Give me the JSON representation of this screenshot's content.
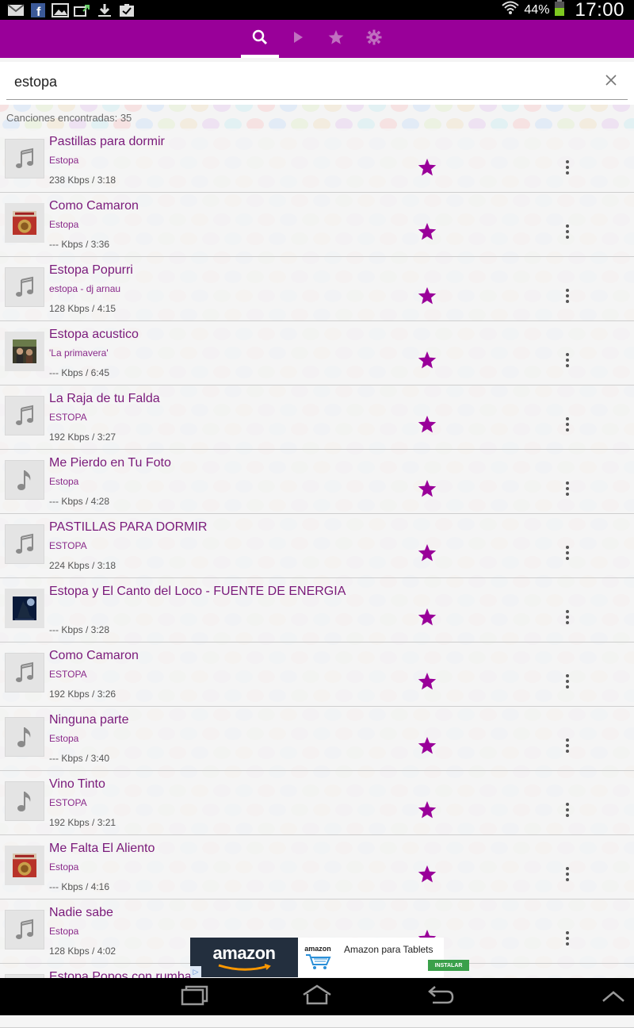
{
  "status_bar": {
    "battery_text": "44%",
    "time": "17:00",
    "notification_icons": [
      "gmail-icon",
      "facebook-icon",
      "gallery-icon",
      "upload-icon",
      "download-icon",
      "clipboard-check-icon"
    ]
  },
  "tabs": [
    {
      "name": "search",
      "icon": "search-icon",
      "active": true
    },
    {
      "name": "play",
      "icon": "play-icon",
      "active": false
    },
    {
      "name": "favorites",
      "icon": "star-icon",
      "active": false
    },
    {
      "name": "settings",
      "icon": "gear-icon",
      "active": false
    }
  ],
  "search": {
    "value": "estopa",
    "placeholder": ""
  },
  "found_text": "Canciones encontradas: 35",
  "songs": [
    {
      "title": "Pastillas para dormir",
      "artist": "Estopa",
      "meta": "238  Kbps / 3:18",
      "thumb": "note"
    },
    {
      "title": "Como Camaron",
      "artist": "Estopa",
      "meta": "--- Kbps / 3:36",
      "thumb": "album-red"
    },
    {
      "title": "Estopa Popurri",
      "artist": "estopa - dj arnau",
      "meta": "128  Kbps / 4:15",
      "thumb": "note"
    },
    {
      "title": "Estopa acustico",
      "artist": "'La primavera'",
      "meta": "--- Kbps / 6:45",
      "thumb": "album-photo"
    },
    {
      "title": "La Raja de tu Falda",
      "artist": "ESTOPA",
      "meta": "192  Kbps / 3:27",
      "thumb": "note"
    },
    {
      "title": "Me Pierdo en Tu Foto",
      "artist": "Estopa",
      "meta": "--- Kbps / 4:28",
      "thumb": "note-single"
    },
    {
      "title": "PASTILLAS PARA DORMIR",
      "artist": "ESTOPA",
      "meta": "224  Kbps / 3:18",
      "thumb": "note"
    },
    {
      "title": "Estopa y El Canto del Loco - FUENTE DE ENERGIA",
      "artist": "",
      "meta": "--- Kbps / 3:28",
      "thumb": "album-wolf"
    },
    {
      "title": "Como Camaron",
      "artist": "ESTOPA",
      "meta": "192  Kbps / 3:26",
      "thumb": "note"
    },
    {
      "title": "Ninguna parte",
      "artist": "Estopa",
      "meta": "--- Kbps / 3:40",
      "thumb": "note-single"
    },
    {
      "title": "Vino Tinto",
      "artist": "ESTOPA",
      "meta": "192  Kbps / 3:21",
      "thumb": "note-single"
    },
    {
      "title": "Me Falta El Aliento",
      "artist": "Estopa",
      "meta": "--- Kbps / 4:16",
      "thumb": "album-red"
    },
    {
      "title": "Nadie sabe",
      "artist": "Estopa",
      "meta": "128  Kbps / 4:02",
      "thumb": "note"
    },
    {
      "title": "Estopa Popos con rumba",
      "artist": "",
      "meta": "",
      "thumb": "note"
    }
  ],
  "ad": {
    "logo_text": "amazon",
    "mini_logo": "amazon",
    "text": "Amazon para Tablets",
    "install_label": "INSTALAR",
    "badge": "▷"
  },
  "colors": {
    "accent": "#990099",
    "star": "#990099",
    "title": "#7a1a7a"
  }
}
